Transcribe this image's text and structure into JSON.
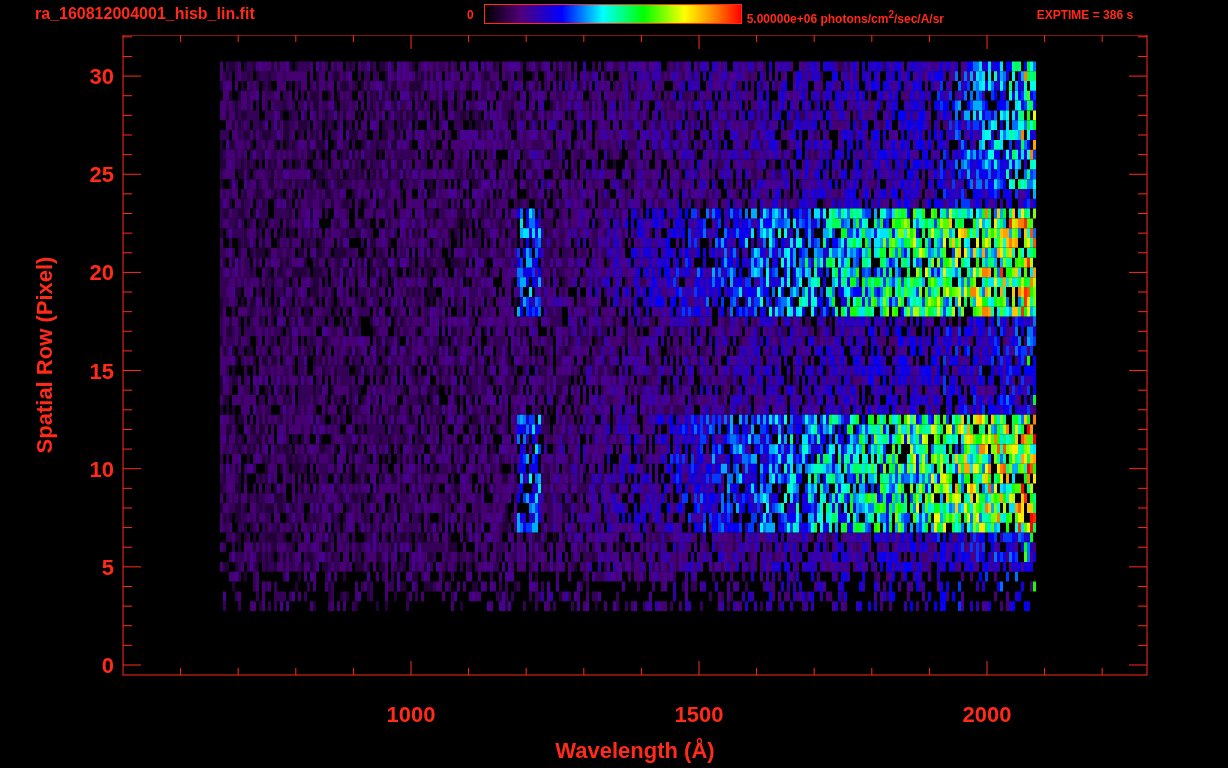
{
  "header": {
    "title": "ra_160812004001_hisb_lin.fit",
    "colorbar": {
      "min_label": "0",
      "max_label": "5.00000e+06 photons/cm$^{2}$/sec/A/sr"
    },
    "exposure": "EXPTIME = 386 s"
  },
  "plot": {
    "xlabel": "Wavelength (Å)",
    "ylabel": "Spatial Row (Pixel)",
    "xticks": [
      "1000",
      "1500",
      "2000"
    ],
    "yticks": [
      "30",
      "25",
      "20",
      "15",
      "10",
      "5",
      "0"
    ]
  }
}
